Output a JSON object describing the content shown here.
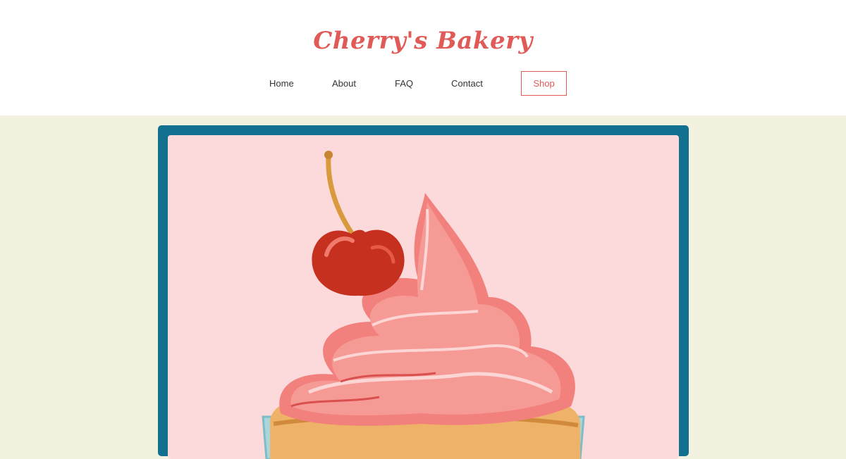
{
  "brand": {
    "title": "Cherry's Bakery",
    "color": "#e05a57"
  },
  "nav": {
    "items": [
      {
        "label": "Home"
      },
      {
        "label": "About"
      },
      {
        "label": "FAQ"
      },
      {
        "label": "Contact"
      }
    ],
    "shop_label": "Shop"
  },
  "hero": {
    "image_subject": "cupcake-with-cherry",
    "frame_color": "#137190",
    "background_color": "#fcdadb"
  },
  "page": {
    "background_color": "#f3f1e0"
  }
}
